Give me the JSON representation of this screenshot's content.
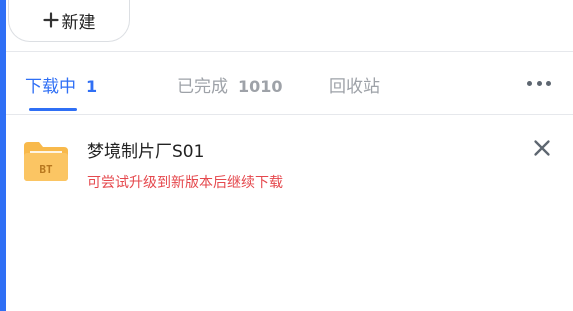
{
  "toolbar": {
    "new_label": "新建"
  },
  "tabs": [
    {
      "label": "下载中",
      "count": "1",
      "active": true
    },
    {
      "label": "已完成",
      "count": "1010",
      "active": false
    },
    {
      "label": "回收站",
      "count": "",
      "active": false
    }
  ],
  "task": {
    "icon_text": "BT",
    "name": "梦境制片厂S01",
    "status": "可尝试升级到新版本后继续下载"
  },
  "icons": {
    "new": "plus-icon",
    "more": "more-horizontal-icon",
    "file": "bt-folder-icon",
    "close": "close-icon"
  },
  "colors": {
    "accent": "#2f6ff5",
    "error": "#e5484d",
    "folder": "#f8b94b",
    "inactive_tab": "#9ea2a8"
  }
}
